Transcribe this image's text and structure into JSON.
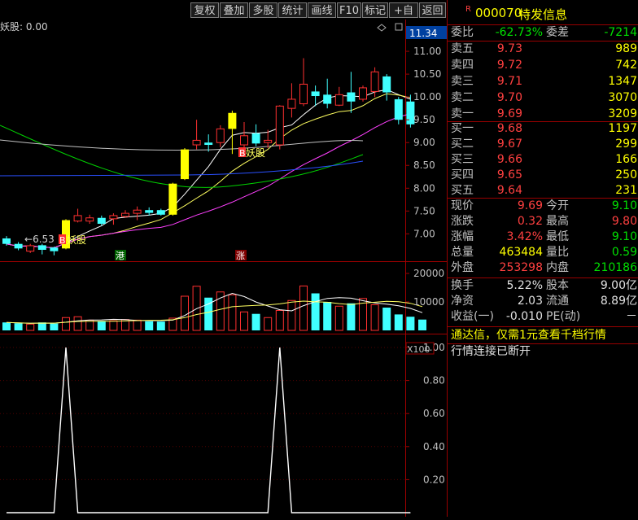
{
  "toolbar": {
    "buttons": [
      "复权",
      "叠加",
      "多股",
      "统计",
      "画线",
      "F10",
      "标记",
      "+自选",
      "返回"
    ]
  },
  "indicator": {
    "name": "妖股",
    "value": "0.00",
    "price_label": "11.34",
    "volume_unit": "X100"
  },
  "price_axis": [
    "11.00",
    "10.50",
    "10.00",
    "9.50",
    "9.00",
    "8.50",
    "8.00",
    "7.50",
    "7.00"
  ],
  "volume_axis": [
    "20000",
    "10000"
  ],
  "signal_axis": [
    "1.00",
    "0.80",
    "0.60",
    "0.40",
    "0.20"
  ],
  "annotations": {
    "low_price": "6.53",
    "signal_mark": "B",
    "signal_label": "妖股",
    "tag_gang": "港",
    "tag_zhang": "涨"
  },
  "chart_data": {
    "type": "candlestick",
    "ylim": [
      6.4,
      11.34
    ],
    "candles": [
      {
        "o": 6.9,
        "c": 6.78,
        "h": 6.95,
        "l": 6.74
      },
      {
        "o": 6.78,
        "c": 6.68,
        "h": 6.82,
        "l": 6.64
      },
      {
        "o": 6.62,
        "c": 6.74,
        "h": 6.78,
        "l": 6.58
      },
      {
        "o": 6.75,
        "c": 6.65,
        "h": 6.78,
        "l": 6.55
      },
      {
        "o": 6.7,
        "c": 6.62,
        "h": 6.72,
        "l": 6.53
      },
      {
        "o": 6.68,
        "c": 7.3,
        "h": 7.32,
        "l": 6.66
      },
      {
        "o": 7.28,
        "c": 7.4,
        "h": 7.55,
        "l": 7.25
      },
      {
        "o": 7.28,
        "c": 7.35,
        "h": 7.42,
        "l": 7.22
      },
      {
        "o": 7.35,
        "c": 7.22,
        "h": 7.4,
        "l": 7.18
      },
      {
        "o": 7.33,
        "c": 7.4,
        "h": 7.45,
        "l": 7.2
      },
      {
        "o": 7.38,
        "c": 7.45,
        "h": 7.52,
        "l": 7.35
      },
      {
        "o": 7.45,
        "c": 7.52,
        "h": 7.6,
        "l": 7.3
      },
      {
        "o": 7.52,
        "c": 7.46,
        "h": 7.58,
        "l": 7.4
      },
      {
        "o": 7.52,
        "c": 7.42,
        "h": 7.55,
        "l": 7.4
      },
      {
        "o": 7.42,
        "c": 8.1,
        "h": 8.12,
        "l": 7.4
      },
      {
        "o": 8.2,
        "c": 8.85,
        "h": 8.88,
        "l": 8.18
      },
      {
        "o": 8.95,
        "c": 9.05,
        "h": 9.5,
        "l": 8.85
      },
      {
        "o": 9.0,
        "c": 8.95,
        "h": 9.18,
        "l": 8.8
      },
      {
        "o": 9.0,
        "c": 9.3,
        "h": 9.38,
        "l": 8.9
      },
      {
        "o": 9.3,
        "c": 9.65,
        "h": 9.7,
        "l": 8.75
      },
      {
        "o": 8.95,
        "c": 9.15,
        "h": 9.45,
        "l": 8.88
      },
      {
        "o": 9.2,
        "c": 8.98,
        "h": 9.4,
        "l": 8.92
      },
      {
        "o": 9.0,
        "c": 9.05,
        "h": 9.28,
        "l": 8.88
      },
      {
        "o": 8.95,
        "c": 9.8,
        "h": 9.82,
        "l": 8.85
      },
      {
        "o": 9.75,
        "c": 9.95,
        "h": 10.3,
        "l": 9.55
      },
      {
        "o": 9.85,
        "c": 10.28,
        "h": 10.85,
        "l": 9.8
      },
      {
        "o": 10.12,
        "c": 10.02,
        "h": 10.25,
        "l": 9.8
      },
      {
        "o": 10.05,
        "c": 9.85,
        "h": 10.4,
        "l": 9.75
      },
      {
        "o": 9.82,
        "c": 10.05,
        "h": 10.22,
        "l": 9.8
      },
      {
        "o": 10.1,
        "c": 9.9,
        "h": 10.55,
        "l": 9.65
      },
      {
        "o": 9.95,
        "c": 10.2,
        "h": 10.25,
        "l": 9.9
      },
      {
        "o": 10.12,
        "c": 10.55,
        "h": 10.65,
        "l": 10.0
      },
      {
        "o": 10.45,
        "c": 10.1,
        "h": 10.5,
        "l": 9.92
      },
      {
        "o": 9.95,
        "c": 9.5,
        "h": 10.0,
        "l": 9.4
      },
      {
        "o": 9.9,
        "c": 9.4,
        "h": 10.05,
        "l": 9.33
      }
    ],
    "volume": [
      2800,
      2500,
      2200,
      2800,
      2400,
      4500,
      4800,
      3600,
      3200,
      3400,
      3800,
      3600,
      3200,
      3100,
      4300,
      12000,
      15500,
      11500,
      13500,
      12500,
      6500,
      5800,
      4500,
      7000,
      10500,
      15600,
      13000,
      10000,
      8500,
      9500,
      11200,
      9000,
      8000,
      5600,
      4800,
      3800
    ],
    "signal": [
      0,
      0,
      0,
      0,
      0,
      1,
      0,
      0,
      0,
      0,
      0,
      0,
      0,
      0,
      0,
      0,
      0,
      0,
      0,
      0,
      0,
      0,
      0,
      1,
      0,
      0,
      0,
      0,
      0,
      0,
      0,
      0,
      0,
      0,
      0
    ]
  },
  "quote": {
    "mark": "R",
    "code": "000070",
    "name": "特发信息",
    "weibi_label": "委比",
    "weibi": "-62.73%",
    "weicha_label": "委差",
    "weicha": "-7214",
    "asks": [
      {
        "label": "卖五",
        "price": "9.73",
        "vol": "989"
      },
      {
        "label": "卖四",
        "price": "9.72",
        "vol": "742"
      },
      {
        "label": "卖三",
        "price": "9.71",
        "vol": "1347"
      },
      {
        "label": "卖二",
        "price": "9.70",
        "vol": "3070"
      },
      {
        "label": "卖一",
        "price": "9.69",
        "vol": "3209"
      }
    ],
    "bids": [
      {
        "label": "买一",
        "price": "9.68",
        "vol": "1197"
      },
      {
        "label": "买二",
        "price": "9.67",
        "vol": "299"
      },
      {
        "label": "买三",
        "price": "9.66",
        "vol": "166"
      },
      {
        "label": "买四",
        "price": "9.65",
        "vol": "250"
      },
      {
        "label": "买五",
        "price": "9.64",
        "vol": "231"
      }
    ],
    "stats": [
      {
        "l1": "现价",
        "v1": "9.69",
        "c1": "red",
        "l2": "今开",
        "v2": "9.10",
        "c2": "green"
      },
      {
        "l1": "涨跌",
        "v1": "0.32",
        "c1": "red",
        "l2": "最高",
        "v2": "9.80",
        "c2": "red"
      },
      {
        "l1": "涨幅",
        "v1": "3.42%",
        "c1": "red",
        "l2": "最低",
        "v2": "9.10",
        "c2": "green"
      },
      {
        "l1": "总量",
        "v1": "463484",
        "c1": "yel",
        "l2": "量比",
        "v2": "0.59",
        "c2": "green"
      },
      {
        "l1": "外盘",
        "v1": "253298",
        "c1": "red",
        "l2": "内盘",
        "v2": "210186",
        "c2": "green"
      }
    ],
    "finance": [
      {
        "l1": "换手",
        "v1": "5.22%",
        "l2": "股本",
        "v2": "9.00亿"
      },
      {
        "l1": "净资",
        "v1": "2.03",
        "l2": "流通",
        "v2": "8.89亿"
      },
      {
        "l1": "收益(一)",
        "v1": "-0.010",
        "l2": "PE(动)",
        "v2": "－"
      }
    ],
    "msg1": "通达信，仅需1元查看千档行情",
    "msg2": "行情连接已断开"
  },
  "colors": {
    "up": "#ff3030",
    "down": "#40ffff",
    "signal_bar": "#ffff00",
    "ma5": "#ffffff",
    "ma10": "#ffff60",
    "ma20": "#ff40ff",
    "ma60": "#00d000",
    "ma120": "#2a50ff",
    "ma250": "#c0c0c0"
  }
}
